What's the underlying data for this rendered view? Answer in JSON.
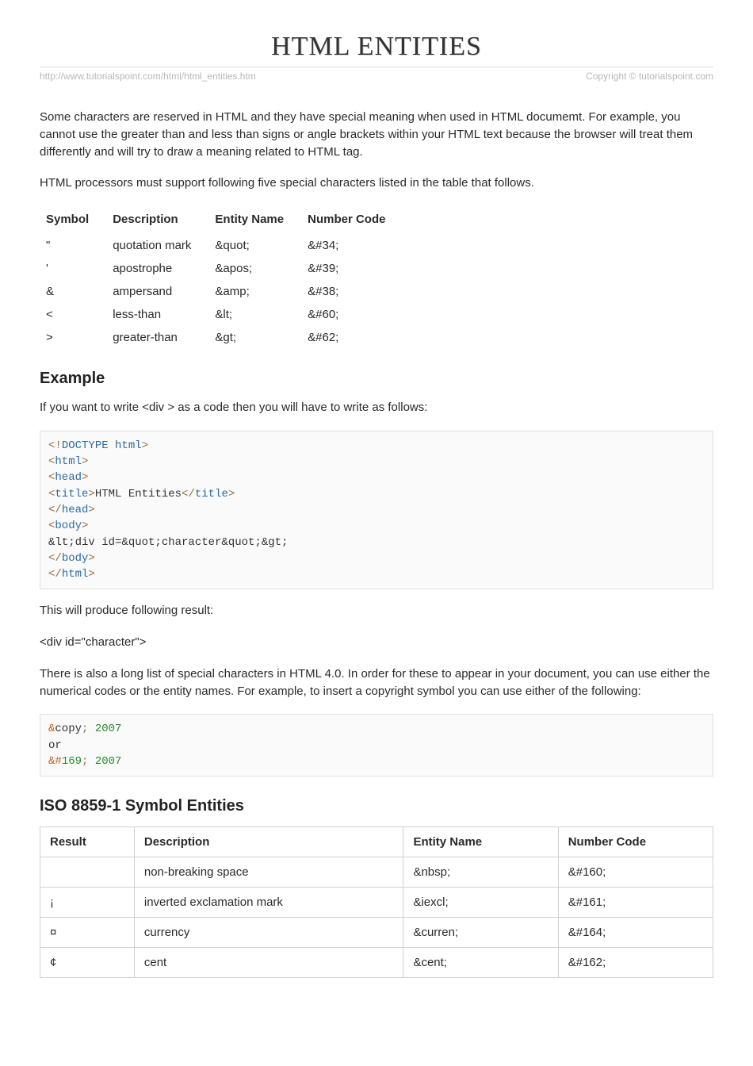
{
  "title": "HTML ENTITIES",
  "meta": {
    "url": "http://www.tutorialspoint.com/html/html_entities.htm",
    "copyright": "Copyright © tutorialspoint.com"
  },
  "intro1": "Some characters are reserved in HTML and they have special meaning when used in HTML documemt. For example, you cannot use the greater than and less than signs or angle brackets within your HTML text because the browser will treat them differently and will try to draw a meaning related to HTML tag.",
  "intro2": "HTML processors must support following five special characters listed in the table that follows.",
  "table1": {
    "headers": [
      "Symbol",
      "Description",
      "Entity Name",
      "Number Code"
    ],
    "rows": [
      {
        "symbol": "\"",
        "desc": "quotation mark",
        "entity": "&quot;",
        "code": "&#34;"
      },
      {
        "symbol": "'",
        "desc": "apostrophe",
        "entity": "&apos;",
        "code": "&#39;"
      },
      {
        "symbol": "&",
        "desc": "ampersand",
        "entity": "&amp;",
        "code": "&#38;"
      },
      {
        "symbol": "<",
        "desc": "less-than",
        "entity": "&lt;",
        "code": "&#60;"
      },
      {
        "symbol": ">",
        "desc": "greater-than",
        "entity": "&gt;",
        "code": "&#62;"
      }
    ]
  },
  "example": {
    "heading": "Example",
    "lead": "If you want to write <div > as a code then you will have to write as follows:",
    "code_lines": [
      {
        "kind": "doctype",
        "text": "<!DOCTYPE html>"
      },
      {
        "kind": "tag-open",
        "name": "html"
      },
      {
        "kind": "tag-open",
        "name": "head"
      },
      {
        "kind": "tag-text",
        "open": "title",
        "text": "HTML Entities",
        "close": "title"
      },
      {
        "kind": "tag-close",
        "name": "head"
      },
      {
        "kind": "tag-open",
        "name": "body"
      },
      {
        "kind": "literal",
        "text": "&lt;div id=&quot;character&quot;&gt;"
      },
      {
        "kind": "tag-close",
        "name": "body"
      },
      {
        "kind": "tag-close",
        "name": "html"
      }
    ],
    "result_lead": "This will produce following result:",
    "result_output": "<div id=\"character\">",
    "longlist": "There is also a long list of special characters in HTML 4.0. In order for these to appear in your document, you can use either the numerical codes or the entity names. For example, to insert a copyright symbol you can use either of the following:",
    "code2_lines": [
      {
        "parts": [
          {
            "t": "ent-amp",
            "v": "&"
          },
          {
            "t": "plain",
            "v": "copy"
          },
          {
            "t": "ent-punc",
            "v": ";"
          },
          {
            "t": "plain",
            "v": " "
          },
          {
            "t": "num",
            "v": "2007"
          }
        ]
      },
      {
        "parts": [
          {
            "t": "plain",
            "v": "or"
          }
        ]
      },
      {
        "parts": [
          {
            "t": "ent-amp",
            "v": "&#"
          },
          {
            "t": "ent-num",
            "v": "169"
          },
          {
            "t": "ent-punc",
            "v": ";"
          },
          {
            "t": "plain",
            "v": " "
          },
          {
            "t": "num",
            "v": "2007"
          }
        ]
      }
    ]
  },
  "iso": {
    "heading": "ISO 8859-1 Symbol Entities",
    "headers": [
      "Result",
      "Description",
      "Entity Name",
      "Number Code"
    ],
    "rows": [
      {
        "result": "",
        "desc": "non-breaking space",
        "entity": "&nbsp;",
        "code": "&#160;"
      },
      {
        "result": "¡",
        "desc": "inverted exclamation mark",
        "entity": "&iexcl;",
        "code": "&#161;"
      },
      {
        "result": "¤",
        "desc": "currency",
        "entity": "&curren;",
        "code": "&#164;"
      },
      {
        "result": "¢",
        "desc": "cent",
        "entity": "&cent;",
        "code": "&#162;"
      }
    ]
  }
}
